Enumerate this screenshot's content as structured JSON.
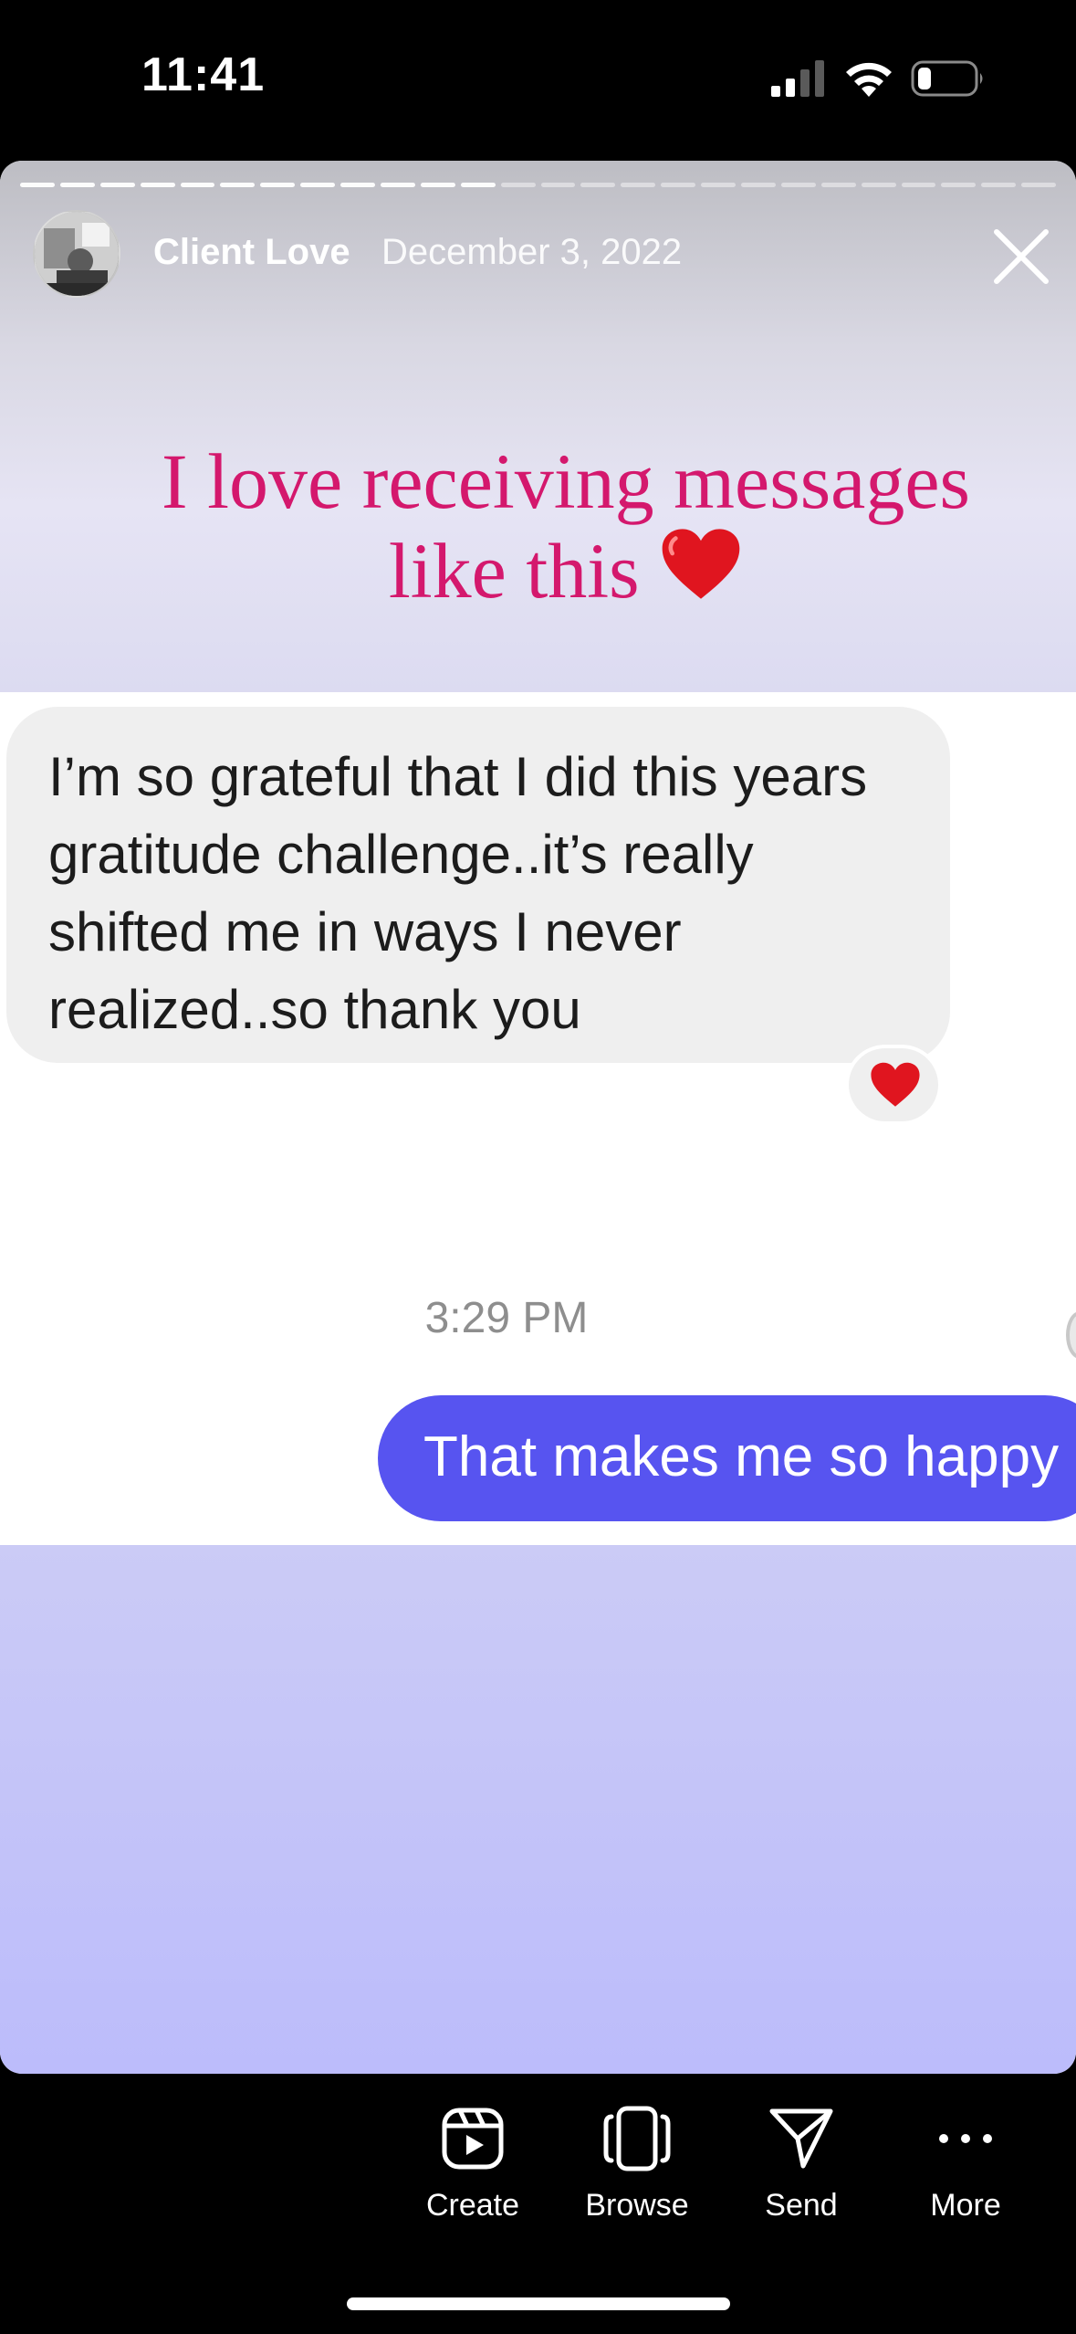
{
  "status_bar": {
    "time": "11:41"
  },
  "story": {
    "account_name": "Client Love",
    "date": "December 3, 2022",
    "progress": {
      "segments_total": 26,
      "segments_viewed": 12
    },
    "headline": {
      "line1": "I love receiving messages",
      "line2": "like this",
      "color": "#d4186d"
    }
  },
  "conversation": {
    "received_message": "I’m so grateful that I did this years gratitude challenge..it’s really shifted me in ways I never realized..so thank you",
    "reaction": "heart",
    "timestamp": "3:29 PM",
    "sent_message": "That makes me so happy",
    "sent_bubble_color": "#5754f0"
  },
  "toolbar": {
    "items": [
      {
        "label": "Create",
        "icon": "reels-create-icon"
      },
      {
        "label": "Browse",
        "icon": "browse-icon"
      },
      {
        "label": "Send",
        "icon": "send-paper-plane-icon"
      },
      {
        "label": "More",
        "icon": "more-dots-icon"
      }
    ]
  }
}
